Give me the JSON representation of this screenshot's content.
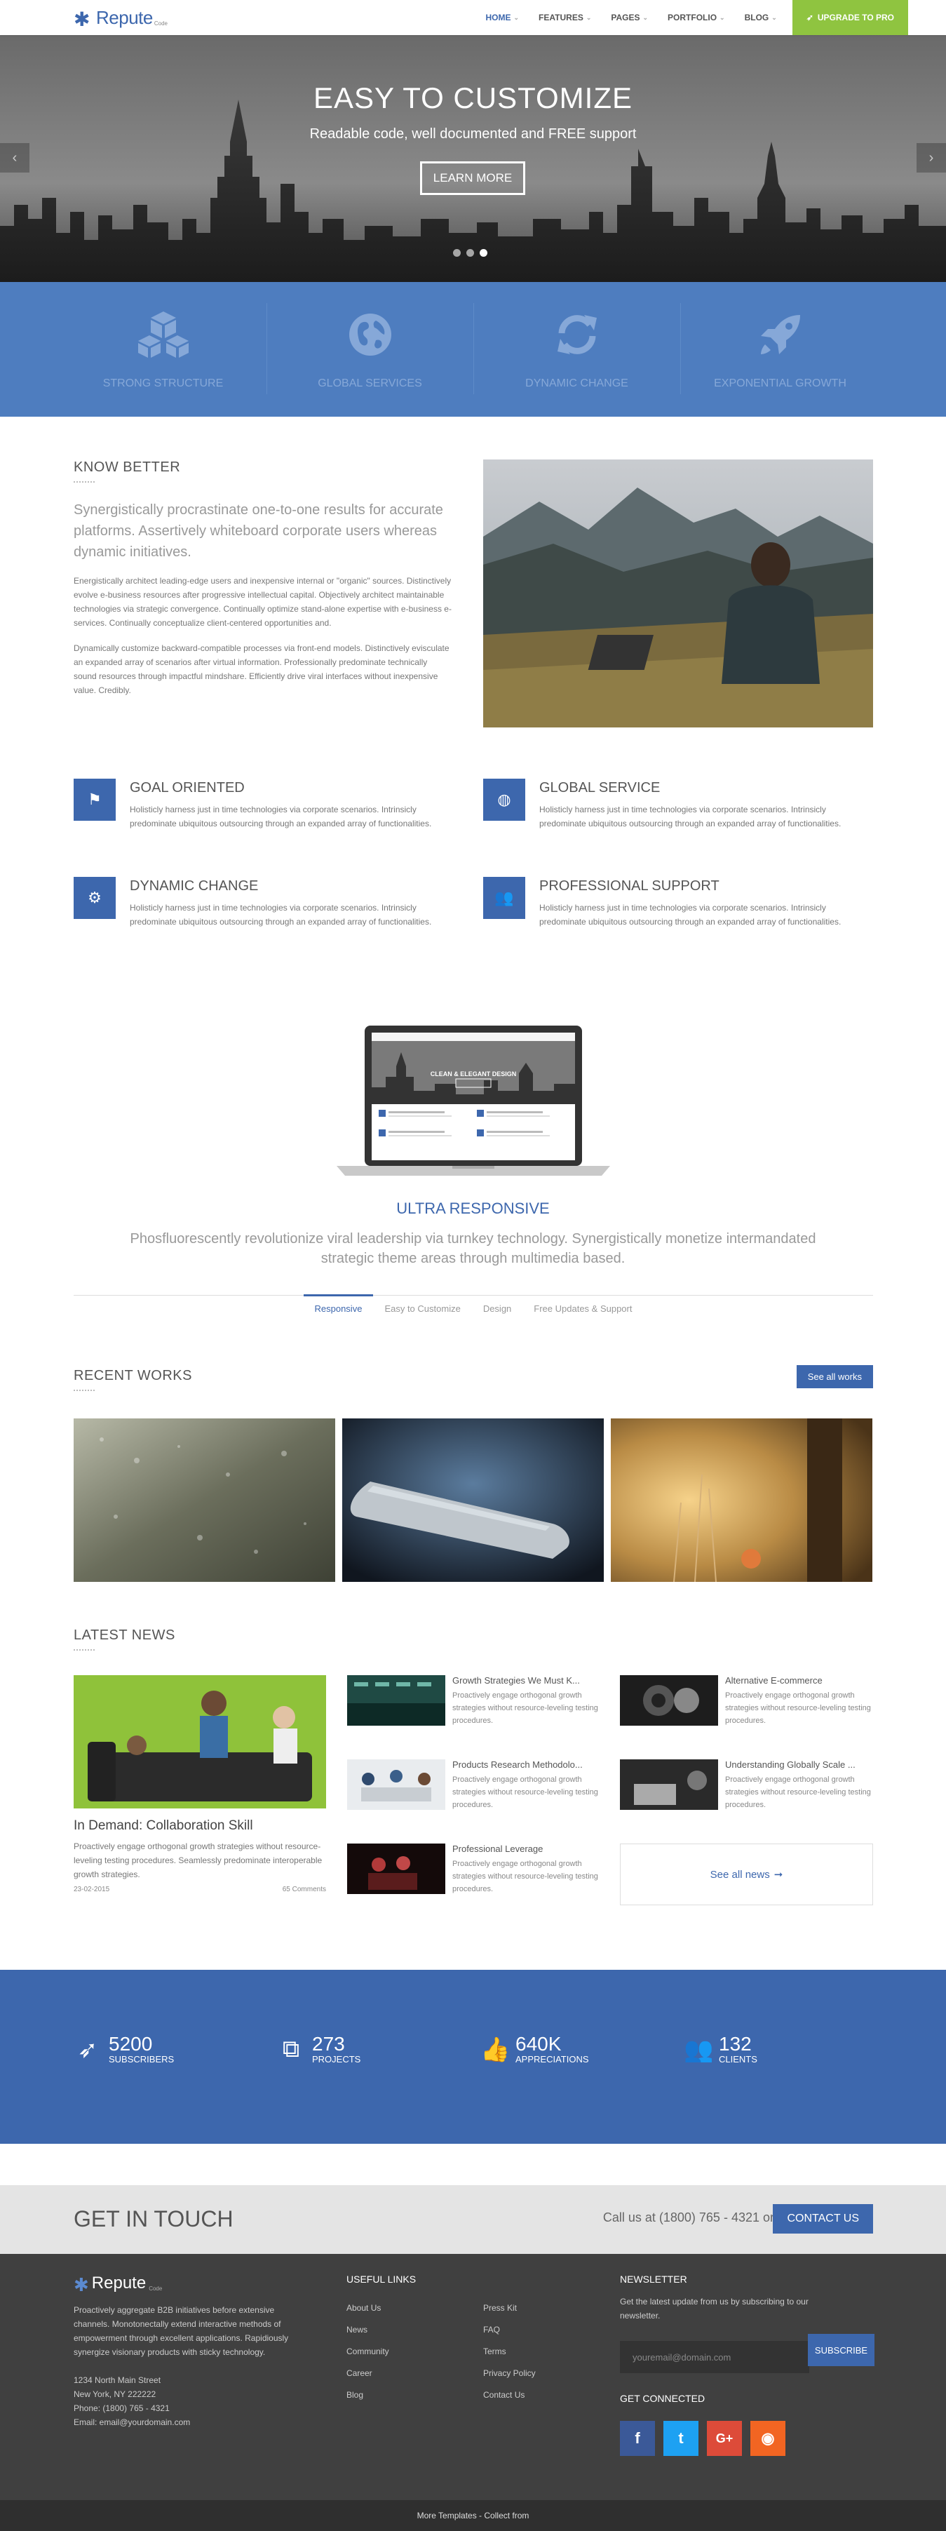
{
  "nav": {
    "logo": "Repute",
    "logo_sub": "Code",
    "items": [
      {
        "label": "HOME",
        "active": true
      },
      {
        "label": "FEATURES"
      },
      {
        "label": "PAGES"
      },
      {
        "label": "PORTFOLIO"
      },
      {
        "label": "BLOG"
      }
    ],
    "pro_label": "UPGRADE TO PRO"
  },
  "hero": {
    "title": "EASY TO CUSTOMIZE",
    "subtitle": "Readable code, well documented and FREE support",
    "button": "LEARN MORE",
    "prev": "‹",
    "next": "›"
  },
  "features": [
    {
      "label": "STRONG STRUCTURE",
      "icon": "cubes-icon"
    },
    {
      "label": "GLOBAL SERVICES",
      "icon": "globe-icon"
    },
    {
      "label": "DYNAMIC CHANGE",
      "icon": "refresh-icon"
    },
    {
      "label": "EXPONENTIAL GROWTH",
      "icon": "rocket-icon"
    }
  ],
  "know": {
    "title": "KNOW BETTER",
    "lead": "Synergistically procrastinate one-to-one results for accurate platforms. Assertively whiteboard corporate users whereas dynamic initiatives.",
    "para1": "Energistically architect leading-edge users and inexpensive internal or \"organic\" sources. Distinctively evolve e-business resources after progressive intellectual capital. Objectively architect maintainable technologies via strategic convergence. Continually optimize stand-alone expertise with e-business e-services. Continually conceptualize client-centered opportunities and.",
    "para2": "Dynamically customize backward-compatible processes via front-end models. Distinctively evisculate an expanded array of scenarios after virtual information. Professionally predominate technically sound resources through impactful mindshare. Efficiently drive viral interfaces without inexpensive value. Credibly."
  },
  "services": [
    {
      "title": "GOAL ORIENTED",
      "icon": "flag-icon",
      "text": "Holisticly harness just in time technologies via corporate scenarios. Intrinsicly predominate ubiquitous outsourcing through an expanded array of functionalities."
    },
    {
      "title": "GLOBAL SERVICE",
      "icon": "globe-icon",
      "text": "Holisticly harness just in time technologies via corporate scenarios. Intrinsicly predominate ubiquitous outsourcing through an expanded array of functionalities."
    },
    {
      "title": "DYNAMIC CHANGE",
      "icon": "gear-icon",
      "text": "Holisticly harness just in time technologies via corporate scenarios. Intrinsicly predominate ubiquitous outsourcing through an expanded array of functionalities."
    },
    {
      "title": "PROFESSIONAL SUPPORT",
      "icon": "users-icon",
      "text": "Holisticly harness just in time technologies via corporate scenarios. Intrinsicly predominate ubiquitous outsourcing through an expanded array of functionalities."
    }
  ],
  "laptop": {
    "screen_title": "CLEAN & ELEGANT DESIGN"
  },
  "responsive": {
    "title": "ULTRA RESPONSIVE",
    "text": "Phosfluorescently revolutionize viral leadership via turnkey technology. Synergistically monetize intermandated strategic theme areas through multimedia based.",
    "tabs": [
      "Responsive",
      "Easy to Customize",
      "Design",
      "Free Updates & Support"
    ]
  },
  "works": {
    "title": "RECENT WORKS",
    "button": "See all works"
  },
  "news": {
    "title": "LATEST NEWS",
    "featured": {
      "title": "In Demand: Collaboration Skill",
      "text": "Proactively engage orthogonal growth strategies without resource-leveling testing procedures. Seamlessly predominate interoperable growth strategies.",
      "date": "23-02-2015",
      "comments": "65 Comments"
    },
    "items": [
      {
        "title": "Growth Strategies We Must K...",
        "text": "Proactively engage orthogonal growth strategies without resource-leveling testing procedures."
      },
      {
        "title": "Alternative E-commerce",
        "text": "Proactively engage orthogonal growth strategies without resource-leveling testing procedures."
      },
      {
        "title": "Products Research Methodolo...",
        "text": "Proactively engage orthogonal growth strategies without resource-leveling testing procedures."
      },
      {
        "title": "Understanding Globally Scale ...",
        "text": "Proactively engage orthogonal growth strategies without resource-leveling testing procedures."
      },
      {
        "title": "Professional Leverage",
        "text": "Proactively engage orthogonal growth strategies without resource-leveling testing procedures."
      }
    ],
    "see_all": "See all news",
    "see_all_arrow": "➞"
  },
  "stats": [
    {
      "num": "5200",
      "label": "SUBSCRIBERS",
      "icon": "rocket-icon"
    },
    {
      "num": "273",
      "label": "PROJECTS",
      "icon": "cubes-icon"
    },
    {
      "num": "640K",
      "label": "APPRECIATIONS",
      "icon": "thumbs-up-icon"
    },
    {
      "num": "132",
      "label": "CLIENTS",
      "icon": "users-icon"
    }
  ],
  "contact": {
    "title": "GET IN TOUCH",
    "call": "Call us at (1800) 765 - 4321 or",
    "button": "CONTACT US"
  },
  "footer": {
    "logo": "Repute",
    "logo_sub": "Code",
    "about": "Proactively aggregate B2B initiatives before extensive channels. Monotonectally extend interactive methods of empowerment through excellent applications. Rapidiously synergize visionary products with sticky technology.",
    "address1": "1234 North Main Street",
    "address2": "New York, NY 222222",
    "phone": "Phone: (1800) 765 - 4321",
    "email": "Email: email@yourdomain.com",
    "links_title": "USEFUL LINKS",
    "links_col1": [
      "About Us",
      "News",
      "Community",
      "Career",
      "Blog"
    ],
    "links_col2": [
      "Press Kit",
      "FAQ",
      "Terms",
      "Privacy Policy",
      "Contact Us"
    ],
    "newsletter_title": "NEWSLETTER",
    "newsletter_text": "Get the latest update from us by subscribing to our newsletter.",
    "email_placeholder": "youremail@domain.com",
    "subscribe": "SUBSCRIBE",
    "connected_title": "GET CONNECTED",
    "social": [
      {
        "name": "facebook-icon",
        "glyph": "f",
        "color": "#3b5998"
      },
      {
        "name": "twitter-icon",
        "glyph": "t",
        "color": "#1da1f2"
      },
      {
        "name": "google-plus-icon",
        "glyph": "G+",
        "color": "#dd4b39"
      },
      {
        "name": "rss-icon",
        "glyph": "◉",
        "color": "#f26522"
      }
    ],
    "copyright": "More Templates - Collect from"
  },
  "colors": {
    "brand": "#3d67ad",
    "accent_green": "#8fc440",
    "feature_bar": "#4e7dbf"
  }
}
